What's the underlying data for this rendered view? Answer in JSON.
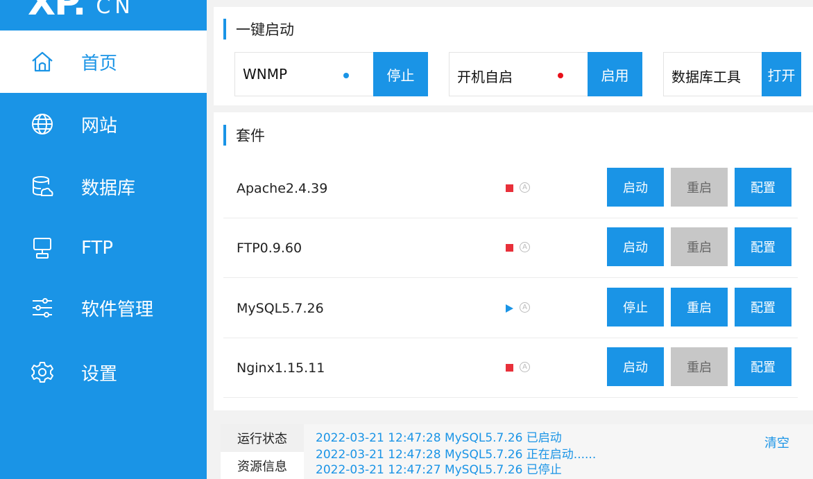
{
  "logo": {
    "main": "XP.",
    "sub": "CN"
  },
  "nav": {
    "items": [
      {
        "label": "首页",
        "icon": "home-icon"
      },
      {
        "label": "网站",
        "icon": "globe-icon"
      },
      {
        "label": "数据库",
        "icon": "database-icon"
      },
      {
        "label": "FTP",
        "icon": "ftp-icon"
      },
      {
        "label": "软件管理",
        "icon": "sliders-icon"
      },
      {
        "label": "设置",
        "icon": "gear-icon"
      }
    ]
  },
  "quickstart": {
    "title": "一键启动",
    "items": [
      {
        "label": "WNMP",
        "button": "停止",
        "dot_color": "#1a94e6"
      },
      {
        "label": "开机自启",
        "button": "启用",
        "dot_color": "#e8101a"
      },
      {
        "label": "数据库工具",
        "button": "打开"
      }
    ]
  },
  "suite": {
    "title": "套件",
    "rows": [
      {
        "name": "Apache2.4.39",
        "status": "stopped",
        "start": "启动",
        "restart": "重启",
        "config": "配置"
      },
      {
        "name": "FTP0.9.60",
        "status": "stopped",
        "start": "启动",
        "restart": "重启",
        "config": "配置"
      },
      {
        "name": "MySQL5.7.26",
        "status": "running",
        "start": "停止",
        "restart": "重启",
        "config": "配置"
      },
      {
        "name": "Nginx1.15.11",
        "status": "stopped",
        "start": "启动",
        "restart": "重启",
        "config": "配置"
      }
    ],
    "auto_glyph": "A"
  },
  "bottom": {
    "tabs": [
      "运行状态",
      "资源信息"
    ],
    "logs": [
      "2022-03-21 12:47:28 MySQL5.7.26 已启动",
      "2022-03-21 12:47:28 MySQL5.7.26 正在启动......",
      "2022-03-21 12:47:27 MySQL5.7.26 已停止"
    ],
    "clear": "清空"
  },
  "colors": {
    "accent": "#1a94e6",
    "stop": "#e8303a",
    "disabled": "#c7c7c7"
  }
}
